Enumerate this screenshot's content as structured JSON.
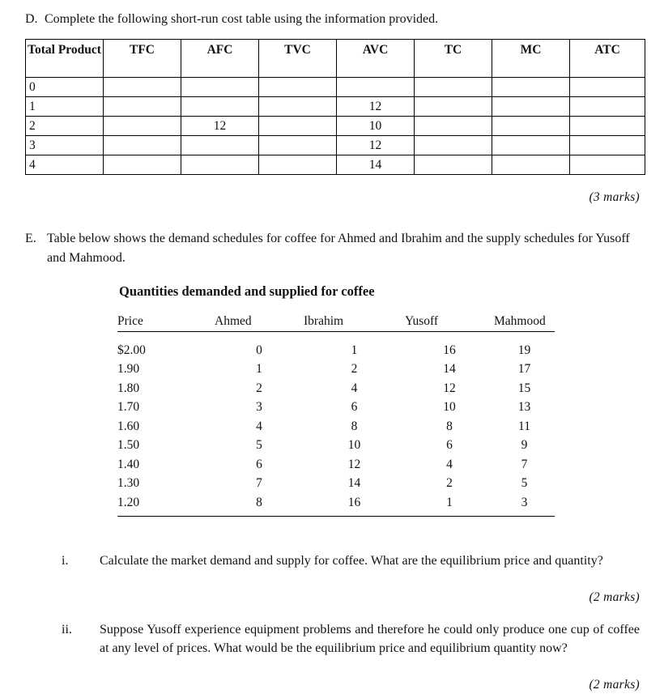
{
  "section_d": {
    "marker": "D.",
    "text": "Complete the following short-run cost table using the information provided.",
    "marks": "(3  marks)",
    "table": {
      "headers": [
        "Total Product",
        "TFC",
        "AFC",
        "TVC",
        "AVC",
        "TC",
        "MC",
        "ATC"
      ],
      "rows": [
        {
          "total_product": "0",
          "tfc": "",
          "afc": "",
          "tvc": "",
          "avc": "",
          "tc": "",
          "mc": "",
          "atc": ""
        },
        {
          "total_product": "1",
          "tfc": "",
          "afc": "",
          "tvc": "",
          "avc": "12",
          "tc": "",
          "mc": "",
          "atc": ""
        },
        {
          "total_product": "2",
          "tfc": "",
          "afc": "12",
          "tvc": "",
          "avc": "10",
          "tc": "",
          "mc": "",
          "atc": ""
        },
        {
          "total_product": "3",
          "tfc": "",
          "afc": "",
          "tvc": "",
          "avc": "12",
          "tc": "",
          "mc": "",
          "atc": ""
        },
        {
          "total_product": "4",
          "tfc": "",
          "afc": "",
          "tvc": "",
          "avc": "14",
          "tc": "",
          "mc": "",
          "atc": ""
        }
      ]
    }
  },
  "section_e": {
    "marker": "E.",
    "text": "Table below shows the demand schedules for coffee for Ahmed and Ibrahim and the supply schedules for Yusoff and Mahmood.",
    "table_title": "Quantities demanded and supplied for coffee",
    "table": {
      "headers": [
        "Price",
        "Ahmed",
        "Ibrahim",
        "Yusoff",
        "Mahmood"
      ],
      "rows": [
        {
          "price": "$2.00",
          "ahmed": "0",
          "ibrahim": "1",
          "yusoff": "16",
          "mahmood": "19"
        },
        {
          "price": "1.90",
          "ahmed": "1",
          "ibrahim": "2",
          "yusoff": "14",
          "mahmood": "17"
        },
        {
          "price": "1.80",
          "ahmed": "2",
          "ibrahim": "4",
          "yusoff": "12",
          "mahmood": "15"
        },
        {
          "price": "1.70",
          "ahmed": "3",
          "ibrahim": "6",
          "yusoff": "10",
          "mahmood": "13"
        },
        {
          "price": "1.60",
          "ahmed": "4",
          "ibrahim": "8",
          "yusoff": "8",
          "mahmood": "11"
        },
        {
          "price": "1.50",
          "ahmed": "5",
          "ibrahim": "10",
          "yusoff": "6",
          "mahmood": "9"
        },
        {
          "price": "1.40",
          "ahmed": "6",
          "ibrahim": "12",
          "yusoff": "4",
          "mahmood": "7"
        },
        {
          "price": "1.30",
          "ahmed": "7",
          "ibrahim": "14",
          "yusoff": "2",
          "mahmood": "5"
        },
        {
          "price": "1.20",
          "ahmed": "8",
          "ibrahim": "16",
          "yusoff": "1",
          "mahmood": "3"
        }
      ]
    },
    "questions": [
      {
        "roman": "i.",
        "text": "Calculate the market demand and supply for coffee. What are the equilibrium price and quantity?",
        "marks": "(2 marks)"
      },
      {
        "roman": "ii.",
        "text": "Suppose Yusoff experience equipment problems and therefore he could only produce one cup of coffee at any level of prices. What would be the equilibrium price and equilibrium quantity now?",
        "marks": "(2 marks)"
      }
    ]
  }
}
